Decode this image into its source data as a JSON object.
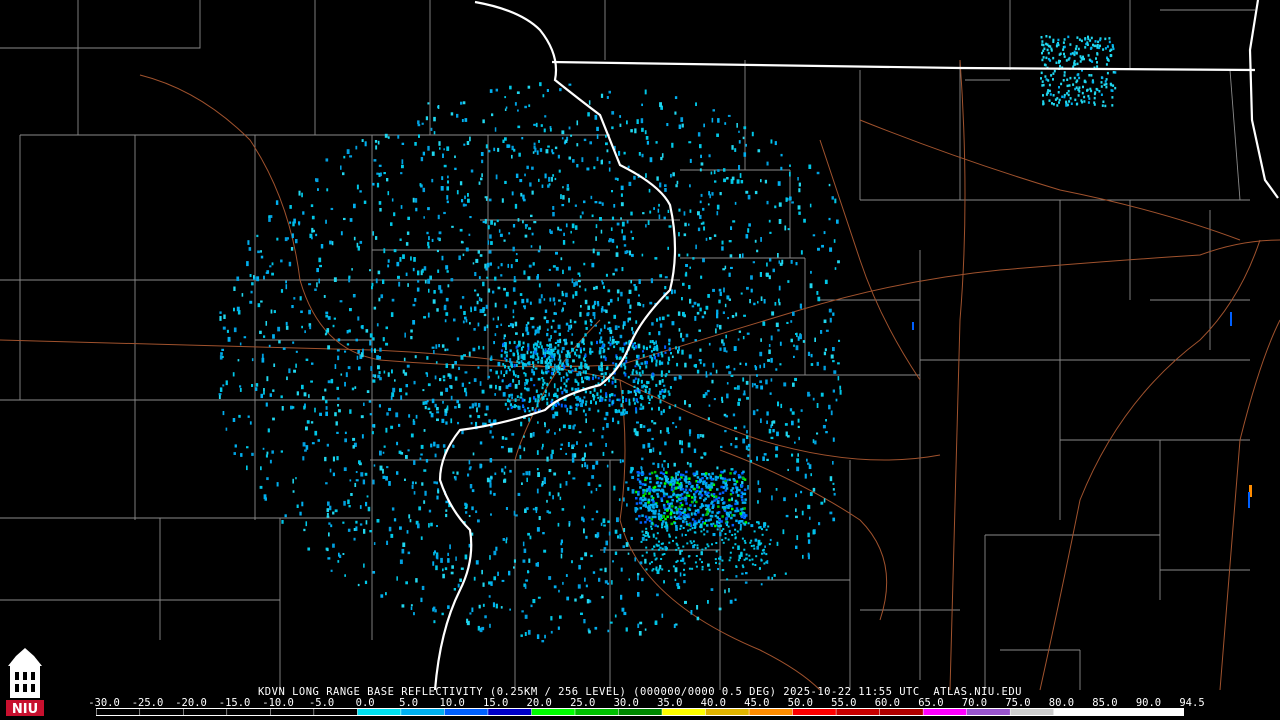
{
  "caption": "KDVN LONG RANGE BASE REFLECTIVITY (0.25KM / 256 LEVEL) (000000/0000 0.5 DEG) 2025-10-22 11:55 UTC  ATLAS.NIU.EDU",
  "scale": {
    "labels": [
      "-30.0",
      "-25.0",
      "-20.0",
      "-15.0",
      "-10.0",
      "-5.0",
      "0.0",
      "5.0",
      "10.0",
      "15.0",
      "20.0",
      "25.0",
      "30.0",
      "35.0",
      "40.0",
      "45.0",
      "50.0",
      "55.0",
      "60.0",
      "65.0",
      "70.0",
      "75.0",
      "80.0",
      "85.0",
      "90.0",
      "94.5"
    ],
    "colors": [
      "#000000",
      "#000000",
      "#000000",
      "#000000",
      "#000000",
      "#000000",
      "#00e0f0",
      "#00b0f0",
      "#0060ff",
      "#0000c8",
      "#00ff00",
      "#00c000",
      "#008800",
      "#ffff00",
      "#e0b400",
      "#ff8c00",
      "#ff0000",
      "#c80000",
      "#b00000",
      "#ff00ff",
      "#9955cc",
      "#cccccc",
      "#ffffff",
      "#ffffff",
      "#ffffff"
    ]
  },
  "logo": {
    "text": "NIU",
    "color": "#c8102e"
  },
  "map_colors": {
    "background": "#000000",
    "county_lines": "#8a8a8a",
    "roads": "#a0522d",
    "state_lines": "#ffffff",
    "echo_light": "#00c8e8",
    "echo_mid": "#0060ff",
    "echo_strong": "#00ff00"
  }
}
